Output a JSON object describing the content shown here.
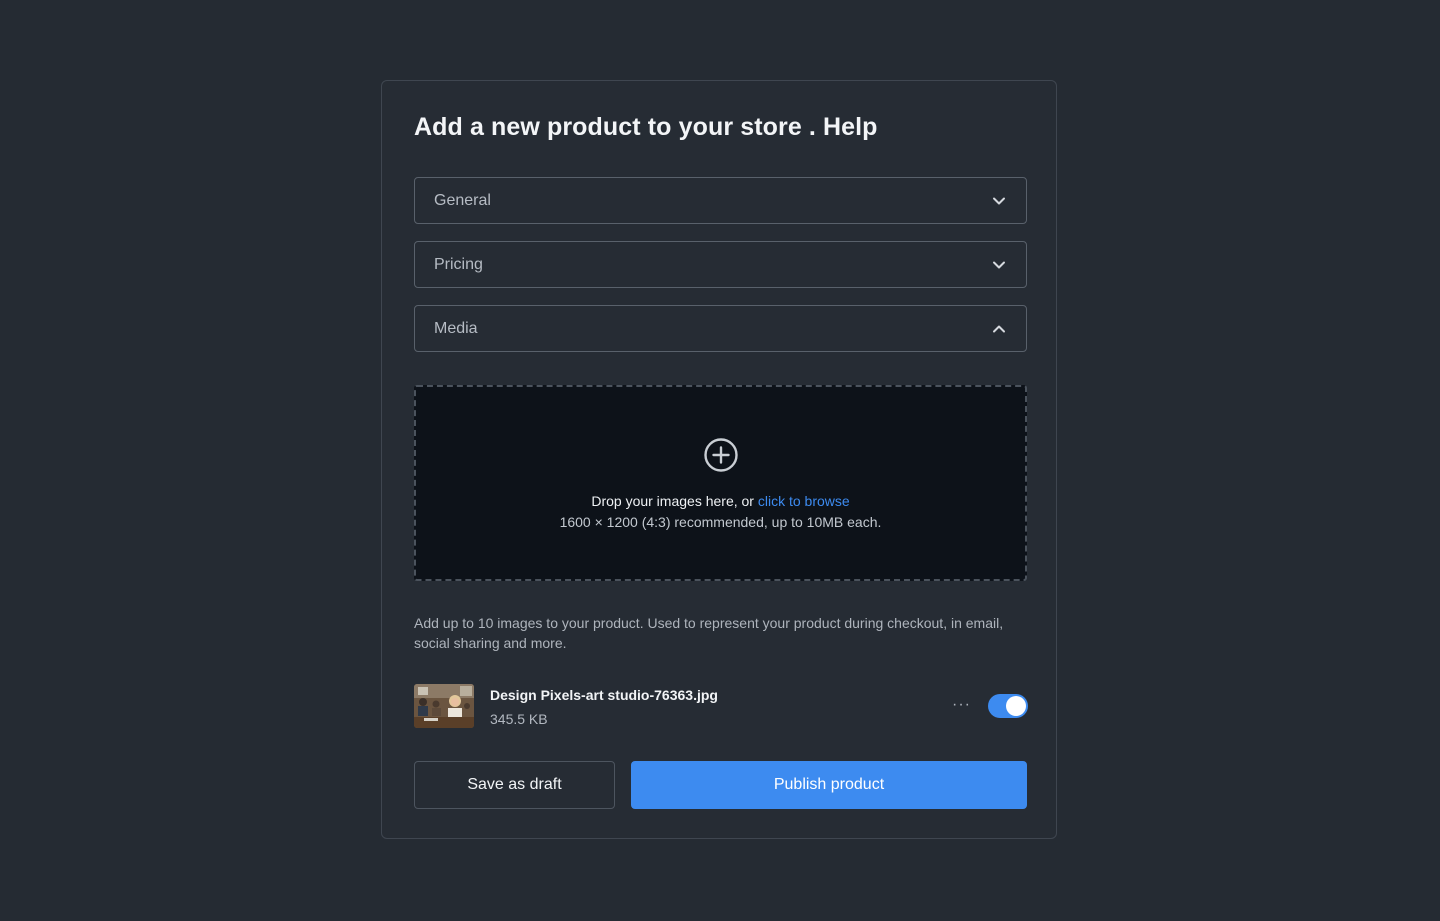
{
  "form": {
    "title": "Add a new product to your store . Help",
    "sections": [
      {
        "label": "General",
        "state": "collapsed",
        "icon": "chevron-down-icon"
      },
      {
        "label": "Pricing",
        "state": "collapsed",
        "icon": "chevron-down-icon"
      },
      {
        "label": "Media",
        "state": "expanded",
        "icon": "chevron-up-icon"
      }
    ]
  },
  "dropzone": {
    "icon": "plus-circle-icon",
    "prompt": "Drop your images here, or",
    "browse_link": "click to browse",
    "hint": "1600 × 1200 (4:3) recommended, up to 10MB each."
  },
  "media_help": "Add up to 10 images to your product. Used to represent your product during checkout, in email, social sharing and more.",
  "files": [
    {
      "name": "Design Pixels-art studio-76363.jpg",
      "size": "345.5 KB",
      "thumbnail": "classroom-photo-thumbnail",
      "more_icon": "more-horizontal-icon",
      "more_label": "···",
      "toggle_on": true
    }
  ],
  "actions": {
    "draft_label": "Save as draft",
    "publish_label": "Publish product"
  },
  "colors": {
    "background": "#252b33",
    "accent": "#3d8bf0",
    "dropzone_bg": "#0d1219"
  }
}
